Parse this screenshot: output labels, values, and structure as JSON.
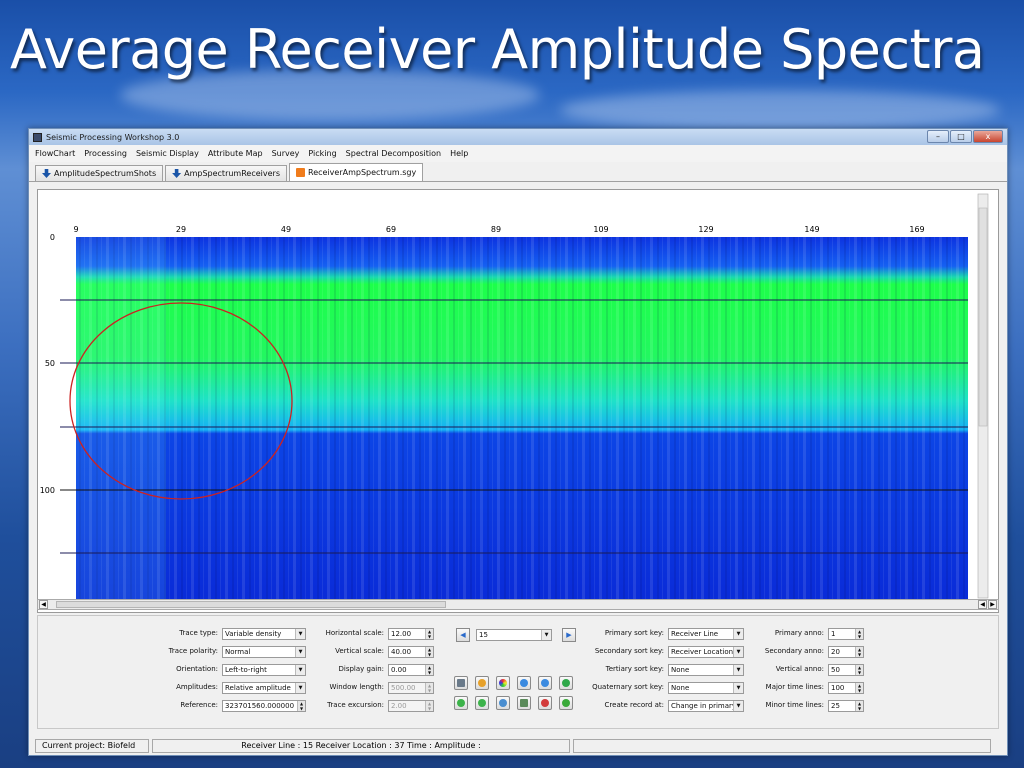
{
  "slide": {
    "title": "Average Receiver Amplitude Spectra"
  },
  "window": {
    "title": "Seismic Processing Workshop 3.0",
    "buttons": {
      "minimize": "–",
      "maximize": "□",
      "close": "x"
    }
  },
  "menu": [
    "FlowChart",
    "Processing",
    "Seismic Display",
    "Attribute Map",
    "Survey",
    "Picking",
    "Spectral Decomposition",
    "Help"
  ],
  "tabs": [
    {
      "label": "AmplitudeSpectrumShots",
      "icon": "download-arrow-icon"
    },
    {
      "label": "AmpSpectrumReceivers",
      "icon": "download-arrow-icon"
    },
    {
      "label": "ReceiverAmpSpectrum.sgy",
      "icon": "sgy-file-icon",
      "active": true
    }
  ],
  "plot": {
    "x_ticks": [
      "9",
      "29",
      "49",
      "69",
      "89",
      "109",
      "129",
      "149",
      "169"
    ],
    "y_ticks": [
      "0",
      "50",
      "100"
    ],
    "colors": {
      "low": "#0a2bd8",
      "mid": "#12c8f0",
      "high": "#1dff4a",
      "annotation": "#cc2222"
    }
  },
  "controls": {
    "trace_type": {
      "label": "Trace type:",
      "value": "Variable density"
    },
    "trace_polarity": {
      "label": "Trace polarity:",
      "value": "Normal"
    },
    "orientation": {
      "label": "Orientation:",
      "value": "Left-to-right"
    },
    "amplitudes": {
      "label": "Amplitudes:",
      "value": "Relative amplitude"
    },
    "reference": {
      "label": "Reference:",
      "value": "323701560.000000"
    },
    "horizontal_scale": {
      "label": "Horizontal scale:",
      "value": "12.00"
    },
    "vertical_scale": {
      "label": "Vertical scale:",
      "value": "40.00"
    },
    "display_gain": {
      "label": "Display gain:",
      "value": "0.00"
    },
    "window_length": {
      "label": "Window length:",
      "value": "500.00"
    },
    "trace_excursion": {
      "label": "Trace excursion:",
      "value": "2.00"
    },
    "record": {
      "value": "15"
    },
    "primary_sort_key": {
      "label": "Primary sort key:",
      "value": "Receiver Line"
    },
    "secondary_sort_key": {
      "label": "Secondary sort key:",
      "value": "Receiver Location"
    },
    "tertiary_sort_key": {
      "label": "Tertiary sort key:",
      "value": "None"
    },
    "quaternary_sort_key": {
      "label": "Quaternary sort key:",
      "value": "None"
    },
    "create_record_at": {
      "label": "Create record at:",
      "value": "Change in primary"
    },
    "primary_anno": {
      "label": "Primary anno:",
      "value": "1"
    },
    "secondary_anno": {
      "label": "Secondary anno:",
      "value": "20"
    },
    "vertical_anno": {
      "label": "Vertical anno:",
      "value": "50"
    },
    "major_time_lines": {
      "label": "Major time lines:",
      "value": "100"
    },
    "minor_time_lines": {
      "label": "Minor time lines:",
      "value": "25"
    }
  },
  "status": {
    "project": "Current project:  Biofeld",
    "info": "Receiver Line : 15   Receiver Location : 37   Time :     Amplitude :"
  }
}
